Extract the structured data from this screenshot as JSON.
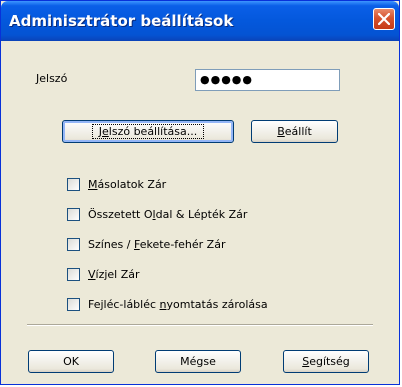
{
  "window": {
    "title": "Adminisztrátor beállítások",
    "close_icon": "close-icon"
  },
  "password": {
    "label_mnemonic": "J",
    "label_rest": "elszó",
    "value": "●●●●●"
  },
  "buttons": {
    "set_password": {
      "pre": "J",
      "mnemonic": "e",
      "post": "lszó beállítása..."
    },
    "apply": {
      "mnemonic": "B",
      "post": "eállít"
    },
    "ok": "OK",
    "cancel": "Mégse",
    "help": {
      "mnemonic": "S",
      "post": "egítség"
    }
  },
  "checkboxes": [
    {
      "pre": "",
      "mnemonic": "M",
      "post": "ásolatok Zár",
      "checked": false
    },
    {
      "pre": "Összetett O",
      "mnemonic": "l",
      "post": "dal & Lépték Zár",
      "checked": false
    },
    {
      "pre": "Színes / ",
      "mnemonic": "F",
      "post": "ekete-fehér Zár",
      "checked": false
    },
    {
      "pre": "",
      "mnemonic": "V",
      "post": "ízjel Zár",
      "checked": false
    },
    {
      "pre": "Fejléc-lábléc ",
      "mnemonic": "n",
      "post": "yomtatás zárolása",
      "checked": false
    }
  ],
  "colors": {
    "titlebar": "#0458dc",
    "dialog_bg": "#ece9d8",
    "close_button": "#d6532e"
  }
}
